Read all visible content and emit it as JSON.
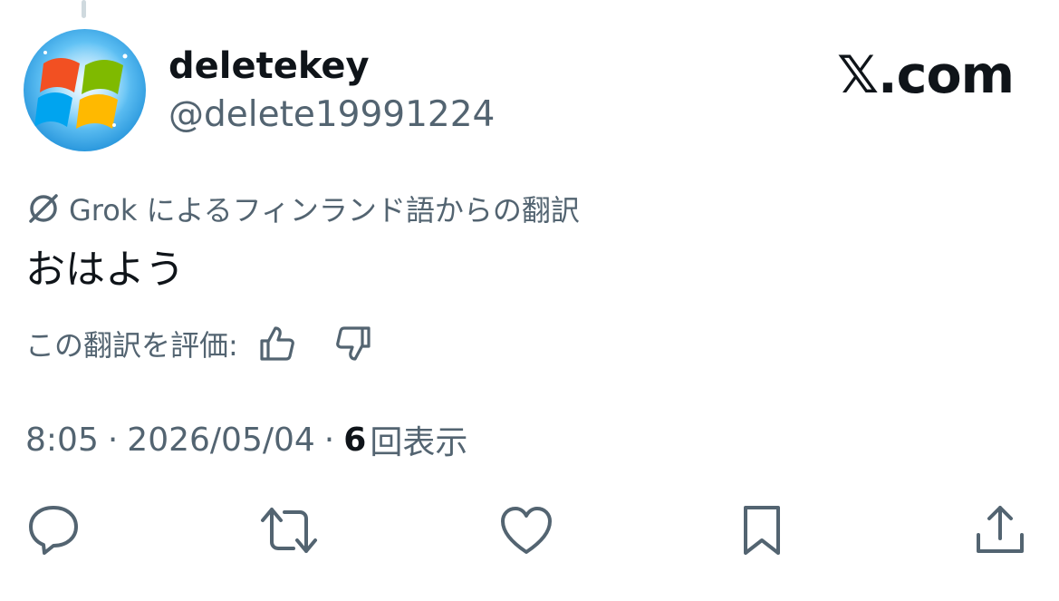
{
  "author": {
    "display_name": "deletekey",
    "handle": "@delete19991224",
    "avatar_icon": "windows-logo-icon"
  },
  "brand": {
    "label": "𝕏.com"
  },
  "translation": {
    "icon": "grok-icon",
    "label": "Grok によるフィンランド語からの翻訳"
  },
  "tweet": {
    "text": "おはよう"
  },
  "rating": {
    "label": "この翻訳を評価:",
    "up_icon": "thumbs-up-icon",
    "down_icon": "thumbs-down-icon"
  },
  "meta": {
    "time": "8:05",
    "separator": "·",
    "date": "2026/05/04",
    "views_count": "6",
    "views_label": "回表示"
  },
  "actions": {
    "reply_icon": "reply-icon",
    "retweet_icon": "retweet-icon",
    "like_icon": "heart-icon",
    "bookmark_icon": "bookmark-icon",
    "share_icon": "share-icon"
  },
  "colors": {
    "text_primary": "#0f1419",
    "text_secondary": "#536471",
    "thread_line": "#cfd9de"
  }
}
